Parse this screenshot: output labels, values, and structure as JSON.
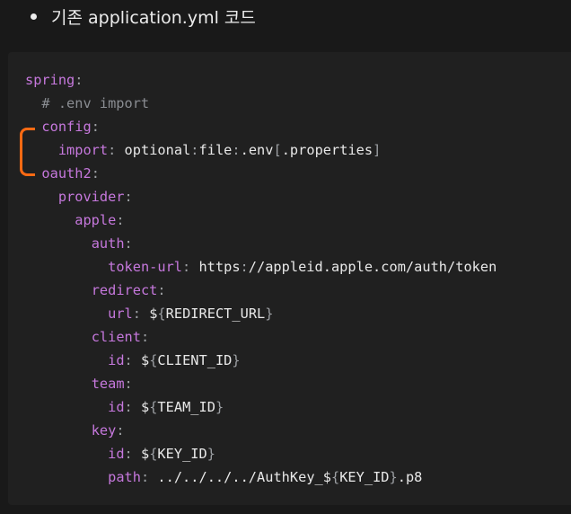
{
  "heading": {
    "text": "기존 application.yml 코드"
  },
  "code": {
    "lines": [
      {
        "indent": "",
        "key": "spring",
        "colon": ":",
        "value": ""
      },
      {
        "indent": "  ",
        "comment": "# .env import"
      },
      {
        "indent": "  ",
        "key": "config",
        "colon": ":",
        "value": ""
      },
      {
        "indent": "    ",
        "key": "import",
        "colon": ":",
        "value": "optional:file:.env[.properties]"
      },
      {
        "indent": "  ",
        "key": "oauth2",
        "colon": ":",
        "value": ""
      },
      {
        "indent": "    ",
        "key": "provider",
        "colon": ":",
        "value": ""
      },
      {
        "indent": "      ",
        "key": "apple",
        "colon": ":",
        "value": ""
      },
      {
        "indent": "        ",
        "key": "auth",
        "colon": ":",
        "value": ""
      },
      {
        "indent": "          ",
        "key": "token-url",
        "colon": ":",
        "value": "https://appleid.apple.com/auth/token"
      },
      {
        "indent": "        ",
        "key": "redirect",
        "colon": ":",
        "value": ""
      },
      {
        "indent": "          ",
        "key": "url",
        "colon": ":",
        "value": "${REDIRECT_URL}"
      },
      {
        "indent": "        ",
        "key": "client",
        "colon": ":",
        "value": ""
      },
      {
        "indent": "          ",
        "key": "id",
        "colon": ":",
        "value": "${CLIENT_ID}"
      },
      {
        "indent": "        ",
        "key": "team",
        "colon": ":",
        "value": ""
      },
      {
        "indent": "          ",
        "key": "id",
        "colon": ":",
        "value": "${TEAM_ID}"
      },
      {
        "indent": "        ",
        "key": "key",
        "colon": ":",
        "value": ""
      },
      {
        "indent": "          ",
        "key": "id",
        "colon": ":",
        "value": "${KEY_ID}"
      },
      {
        "indent": "          ",
        "key": "path",
        "colon": ":",
        "value": "../../../../AuthKey_${KEY_ID}.p8"
      }
    ]
  },
  "annotation": {
    "color": "#ff6a13"
  },
  "colors": {
    "background": "#191919",
    "code_background": "#202020",
    "key": "#c678dd",
    "punctuation": "#9da0a4",
    "comment": "#8a8d92",
    "text": "#e8e8e8"
  }
}
